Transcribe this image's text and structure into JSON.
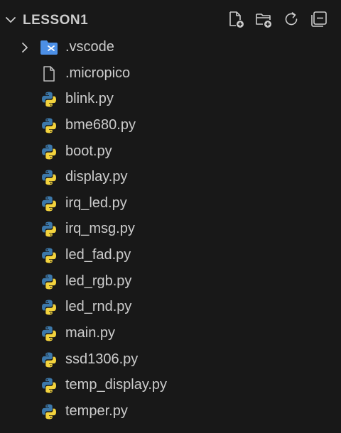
{
  "explorer": {
    "section_title": "LESSON1",
    "actions": [
      {
        "name": "new-file-icon"
      },
      {
        "name": "new-folder-icon"
      },
      {
        "name": "refresh-icon"
      },
      {
        "name": "collapse-all-icon"
      }
    ],
    "items": [
      {
        "label": ".vscode",
        "type": "folder",
        "icon": "vscode-folder-icon",
        "collapsed": true
      },
      {
        "label": ".micropico",
        "type": "file",
        "icon": "file-icon"
      },
      {
        "label": "blink.py",
        "type": "file",
        "icon": "python-icon"
      },
      {
        "label": "bme680.py",
        "type": "file",
        "icon": "python-icon"
      },
      {
        "label": "boot.py",
        "type": "file",
        "icon": "python-icon"
      },
      {
        "label": "display.py",
        "type": "file",
        "icon": "python-icon"
      },
      {
        "label": "irq_led.py",
        "type": "file",
        "icon": "python-icon"
      },
      {
        "label": "irq_msg.py",
        "type": "file",
        "icon": "python-icon"
      },
      {
        "label": "led_fad.py",
        "type": "file",
        "icon": "python-icon"
      },
      {
        "label": "led_rgb.py",
        "type": "file",
        "icon": "python-icon"
      },
      {
        "label": "led_rnd.py",
        "type": "file",
        "icon": "python-icon"
      },
      {
        "label": "main.py",
        "type": "file",
        "icon": "python-icon"
      },
      {
        "label": "ssd1306.py",
        "type": "file",
        "icon": "python-icon"
      },
      {
        "label": "temp_display.py",
        "type": "file",
        "icon": "python-icon"
      },
      {
        "label": "temper.py",
        "type": "file",
        "icon": "python-icon"
      }
    ]
  },
  "colors": {
    "background": "#181818",
    "text": "#cccccc",
    "folder_blue": "#4c8fe6",
    "python_blue": "#3c78aa",
    "python_yellow": "#f3d33d"
  }
}
